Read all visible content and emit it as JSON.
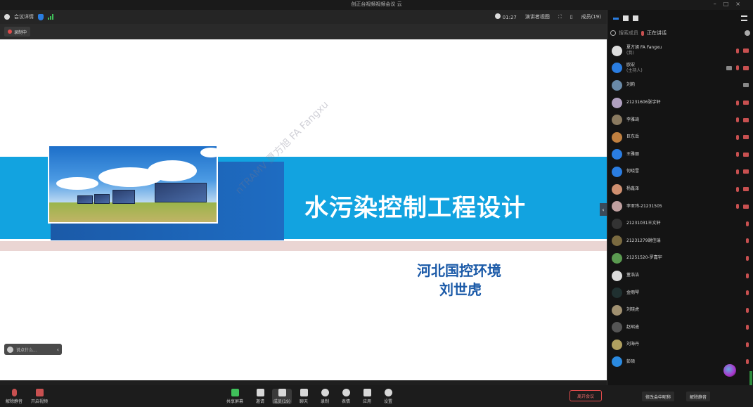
{
  "window": {
    "title": "创正台视频视频会议 云"
  },
  "topbar": {
    "meeting_info": "会议详情",
    "timer": "01:27",
    "speaker_view": "演讲者视图",
    "participants_count": "成员(19)"
  },
  "recording": {
    "label": "录制中"
  },
  "slide": {
    "title": "水污染控制工程设计",
    "org": "河北国控环境",
    "person": "刘世虎",
    "watermark": "nTRAMV 夏方旭 FA Fangxu"
  },
  "chat_pill": {
    "placeholder": "说点什么..."
  },
  "sidebar": {
    "search_placeholder": "搜索成员",
    "selected_tag": "正在讲话",
    "participants": [
      {
        "name": "夏方旭 FA Fangxu",
        "sub": "(我)",
        "avatar": "#ddd",
        "icons": [
          "mic",
          "cam"
        ]
      },
      {
        "name": "欧宏",
        "sub": "(主持人)",
        "avatar": "#2a7de1",
        "icons": [
          "share",
          "mic",
          "cam"
        ]
      },
      {
        "name": "刘莉",
        "sub": "",
        "avatar": "#6a8aa8",
        "icons": [
          "chat"
        ]
      },
      {
        "name": "21231606张宇轩",
        "sub": "",
        "avatar": "#b0a0c0",
        "icons": [
          "mic",
          "cam"
        ]
      },
      {
        "name": "李雅琦",
        "sub": "",
        "avatar": "#8a7a60",
        "icons": [
          "mic",
          "cam"
        ]
      },
      {
        "name": "巨东岳",
        "sub": "",
        "avatar": "#c08040",
        "icons": [
          "mic",
          "cam"
        ]
      },
      {
        "name": "王雅丽",
        "sub": "",
        "avatar": "#2a7de1",
        "icons": [
          "mic",
          "cam"
        ]
      },
      {
        "name": "何晓雪",
        "sub": "",
        "avatar": "#2a7de1",
        "icons": [
          "mic",
          "cam"
        ]
      },
      {
        "name": "杨鑫泽",
        "sub": "",
        "avatar": "#d09070",
        "icons": [
          "mic",
          "cam"
        ]
      },
      {
        "name": "李亚玮-21231505",
        "sub": "",
        "avatar": "#c0a0a0",
        "icons": [
          "mic",
          "cam"
        ]
      },
      {
        "name": "21231031王文轩",
        "sub": "",
        "avatar": "#333",
        "icons": [
          "mic"
        ]
      },
      {
        "name": "21231279谢佳瑞",
        "sub": "",
        "avatar": "#7a6a40",
        "icons": [
          "mic"
        ]
      },
      {
        "name": "21251520-罗嘉宇",
        "sub": "",
        "avatar": "#5a9a50",
        "icons": [
          "mic"
        ]
      },
      {
        "name": "董浩洁",
        "sub": "",
        "avatar": "#ddd",
        "icons": [
          "mic"
        ]
      },
      {
        "name": "金雨琴",
        "sub": "",
        "avatar": "#203030",
        "icons": [
          "mic"
        ]
      },
      {
        "name": "刘晓虎",
        "sub": "",
        "avatar": "#a09070",
        "icons": [
          "mic"
        ]
      },
      {
        "name": "赵昭迪",
        "sub": "",
        "avatar": "#555",
        "icons": [
          "mic"
        ]
      },
      {
        "name": "刘海丹",
        "sub": "",
        "avatar": "#b0a060",
        "icons": [
          "mic"
        ]
      },
      {
        "name": "彭硕",
        "sub": "",
        "avatar": "#2a8ae1",
        "icons": [
          "mic"
        ]
      }
    ]
  },
  "bottombar": {
    "mute_label": "解除静音",
    "video_label": "开启视频",
    "share_label": "共享屏幕",
    "invite_label": "邀请",
    "members_label": "成员(19)",
    "chat_label": "聊天",
    "record_label": "录制",
    "react_label": "表情",
    "apps_label": "应用",
    "settings_label": "设置",
    "end_label": "离开会议",
    "rename_label": "修改会中昵称",
    "unmute_all_label": "解除静音"
  },
  "colors": {
    "accent": "#12a3e0",
    "dark_blue": "#1b5aa8",
    "danger": "#e14b4b"
  }
}
